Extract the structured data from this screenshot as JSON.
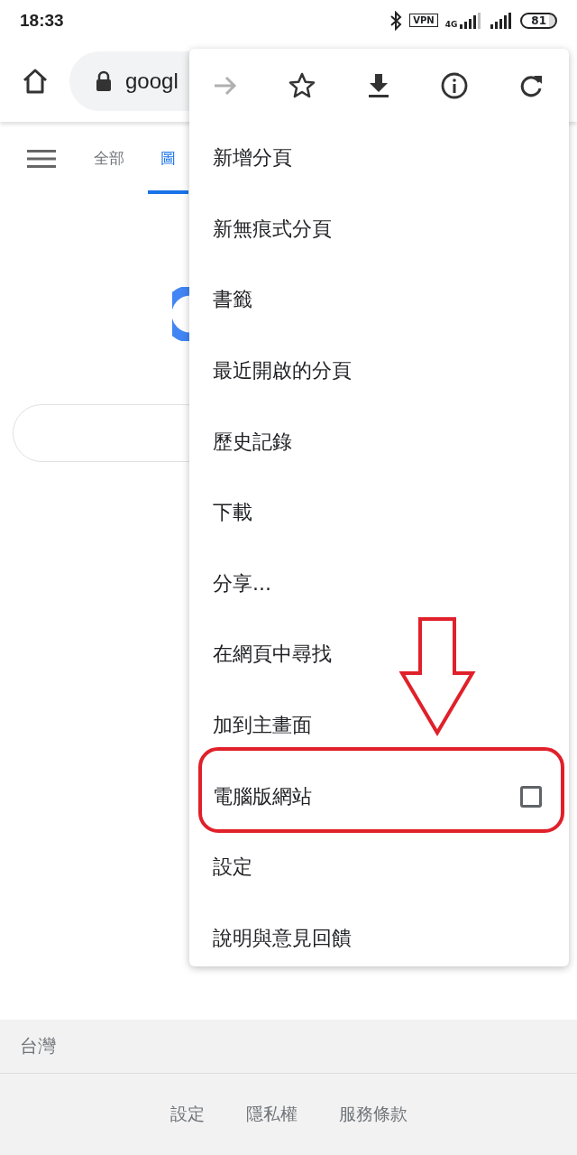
{
  "status_bar": {
    "time": "18:33",
    "vpn": "VPN",
    "network": "4G",
    "battery": "81"
  },
  "toolbar": {
    "url": "googl"
  },
  "tabs": [
    {
      "label": "全部",
      "selected": false
    },
    {
      "label": "圖",
      "selected": true
    }
  ],
  "menu": {
    "actions": [
      {
        "kind": "forward",
        "disabled": true
      },
      {
        "kind": "bookmark",
        "disabled": false
      },
      {
        "kind": "download",
        "disabled": false
      },
      {
        "kind": "info",
        "disabled": false
      },
      {
        "kind": "reload",
        "disabled": false
      }
    ],
    "items": [
      {
        "label": "新增分頁",
        "kind": "plain"
      },
      {
        "label": "新無痕式分頁",
        "kind": "plain"
      },
      {
        "label": "書籤",
        "kind": "plain"
      },
      {
        "label": "最近開啟的分頁",
        "kind": "plain"
      },
      {
        "label": "歷史記錄",
        "kind": "plain"
      },
      {
        "label": "下載",
        "kind": "plain"
      },
      {
        "label": "分享...",
        "kind": "plain"
      },
      {
        "label": "在網頁中尋找",
        "kind": "plain"
      },
      {
        "label": "加到主畫面",
        "kind": "plain"
      },
      {
        "label": "電腦版網站",
        "kind": "checkbox",
        "checked": false
      },
      {
        "label": "設定",
        "kind": "plain"
      },
      {
        "label": "說明與意見回饋",
        "kind": "plain"
      }
    ]
  },
  "footer": {
    "region": "台灣",
    "links": [
      "設定",
      "隱私權",
      "服務條款"
    ]
  }
}
